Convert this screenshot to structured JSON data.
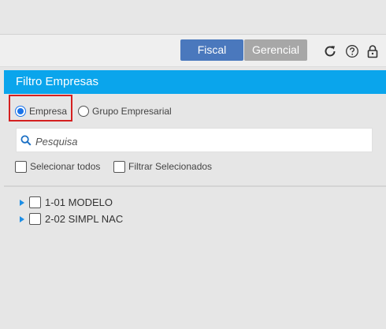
{
  "toolbar": {
    "tabs": [
      {
        "label": "Fiscal",
        "active": true
      },
      {
        "label": "Gerencial",
        "active": false
      }
    ],
    "icons": [
      "refresh-icon",
      "help-icon",
      "lock-icon"
    ]
  },
  "filter": {
    "title": "Filtro Empresas",
    "radio_options": [
      {
        "label": "Empresa",
        "selected": true
      },
      {
        "label": "Grupo Empresarial",
        "selected": false
      }
    ],
    "search_placeholder": "Pesquisa",
    "select_all_label": "Selecionar todos",
    "filter_selected_label": "Filtrar Selecionados",
    "companies": [
      {
        "label": "1-01 MODELO",
        "checked": false
      },
      {
        "label": "2-02 SIMPL NAC",
        "checked": false
      }
    ]
  },
  "colors": {
    "tab_active": "#4a78bd",
    "tab_inactive": "#a7a7a7",
    "panel_header": "#0aa5ec",
    "highlight": "#d42020",
    "expander": "#1c8ee6"
  }
}
